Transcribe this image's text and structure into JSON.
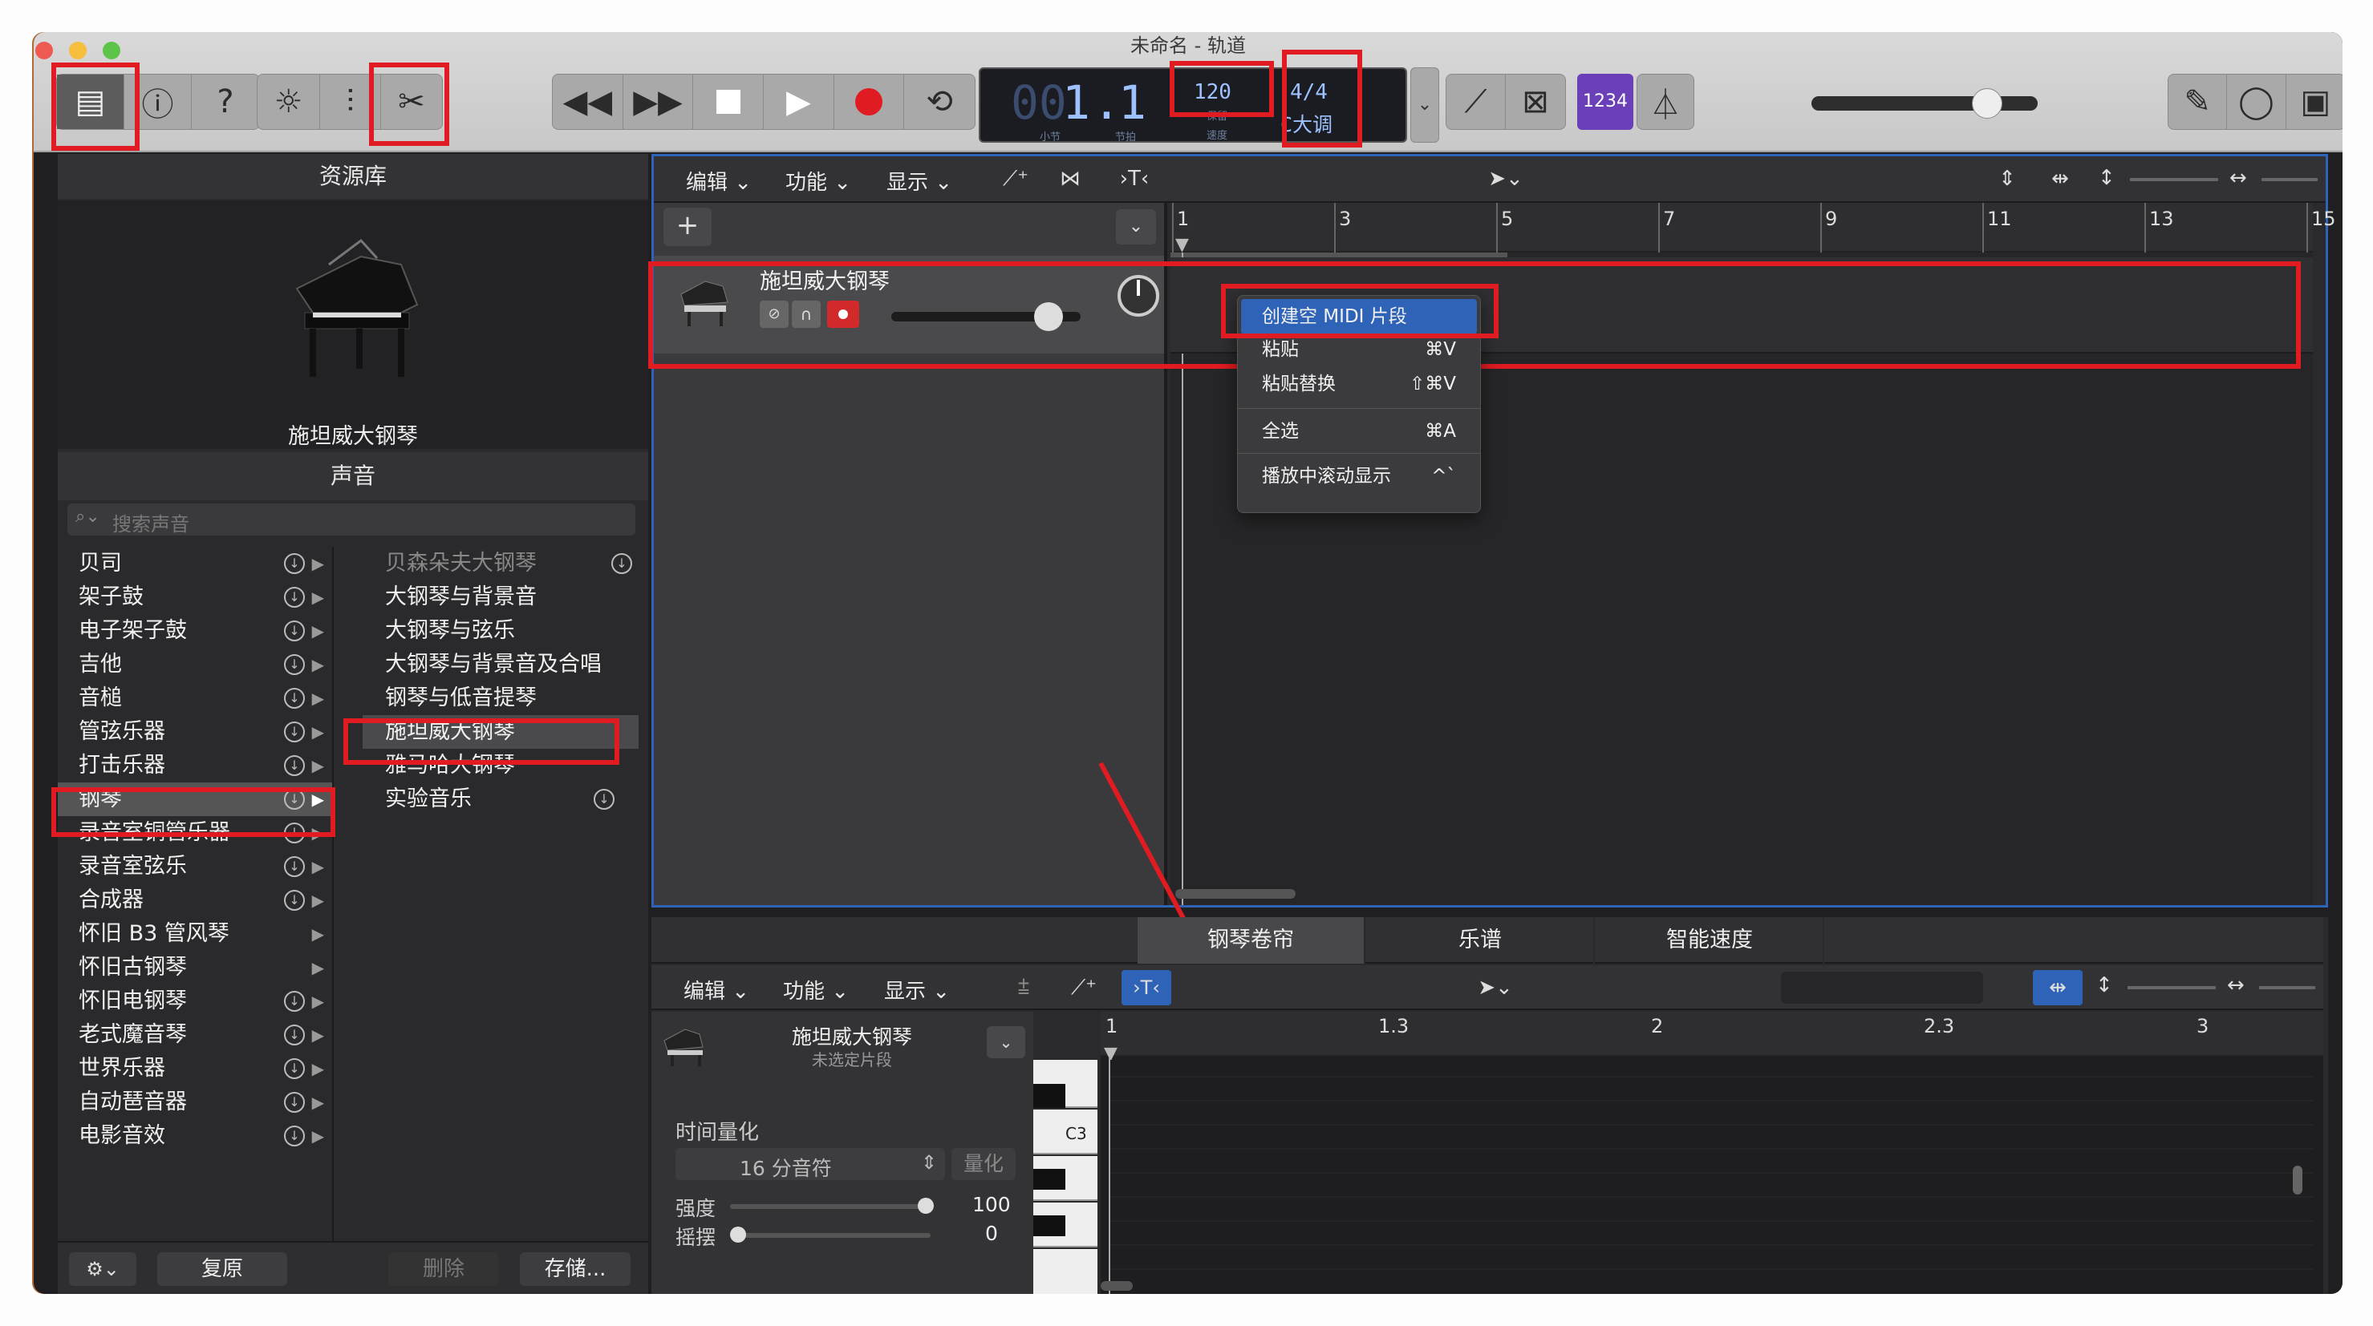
{
  "window": {
    "title": "未命名 - 轨道"
  },
  "lcd": {
    "bar": "1",
    "beat": "1",
    "bar_label": "小节",
    "beat_label": "节拍",
    "tempo": "120",
    "tempo_label1": "保留",
    "tempo_label2": "速度",
    "signature": "4/4",
    "key": "C大调",
    "count_in": "1234"
  },
  "library": {
    "title": "资源库",
    "instrument_name": "施坦威大钢琴",
    "sounds_header": "声音",
    "search_placeholder": "搜索声音",
    "categories": [
      "贝司",
      "架子鼓",
      "电子架子鼓",
      "吉他",
      "音槌",
      "管弦乐器",
      "打击乐器",
      "钢琴",
      "录音室铜管乐器",
      "录音室弦乐",
      "合成器",
      "怀旧 B3 管风琴",
      "怀旧古钢琴",
      "怀旧电钢琴",
      "老式魔音琴",
      "世界乐器",
      "自动琶音器",
      "电影音效"
    ],
    "patches": [
      "贝森朵夫大钢琴",
      "大钢琴与背景音",
      "大钢琴与弦乐",
      "大钢琴与背景音及合唱",
      "钢琴与低音提琴",
      "施坦威大钢琴",
      "雅马哈大钢琴",
      "实验音乐"
    ],
    "footer": {
      "revert": "复原",
      "delete": "删除",
      "save": "存储..."
    }
  },
  "tracks_toolbar": {
    "edit": "编辑",
    "functions": "功能",
    "view": "显示"
  },
  "ruler": [
    "1",
    "3",
    "5",
    "7",
    "9",
    "11",
    "13",
    "15"
  ],
  "track": {
    "name": "施坦威大钢琴"
  },
  "context_menu": {
    "items": [
      {
        "label": "创建空 MIDI 片段",
        "shortcut": ""
      },
      {
        "label": "粘贴",
        "shortcut": "⌘V"
      },
      {
        "label": "粘贴替换",
        "shortcut": "⇧⌘V"
      },
      {
        "label": "全选",
        "shortcut": "⌘A"
      },
      {
        "label": "播放中滚动显示",
        "shortcut": "^`"
      }
    ]
  },
  "bottom_tabs": [
    "钢琴卷帘",
    "乐谱",
    "智能速度"
  ],
  "piano_roll": {
    "toolbar": {
      "edit": "编辑",
      "functions": "功能",
      "view": "显示"
    },
    "region_name": "施坦威大钢琴",
    "region_status": "未选定片段",
    "quantize_title": "时间量化",
    "quantize_value": "16 分音符",
    "quantize_btn": "量化",
    "strength_label": "强度",
    "strength_value": "100",
    "swing_label": "摇摆",
    "swing_value": "0",
    "ruler": [
      "1",
      "1.3",
      "2",
      "2.3",
      "3"
    ],
    "key_label": "C3"
  },
  "colors": {
    "highlight_red": "#e01b22",
    "selection_blue": "#2f63b8",
    "count_in_purple": "#6b3fb8"
  }
}
